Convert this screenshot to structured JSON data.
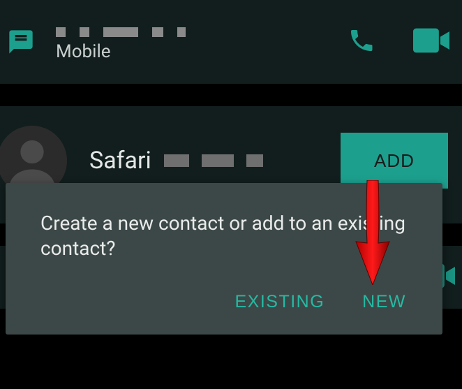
{
  "header": {
    "label": "Mobile"
  },
  "card": {
    "title_text": "Safari",
    "add_label": "ADD"
  },
  "dialog": {
    "message": "Create a new contact or add to an existing contact?",
    "existing_label": "EXISTING",
    "new_label": "NEW"
  },
  "icons": {
    "message": "message-icon",
    "call": "call-icon",
    "video": "video-icon",
    "avatar": "avatar-icon"
  },
  "colors": {
    "accent": "#1d9f8e",
    "dialog_bg": "#3c4847",
    "arrow": "#e60000"
  }
}
